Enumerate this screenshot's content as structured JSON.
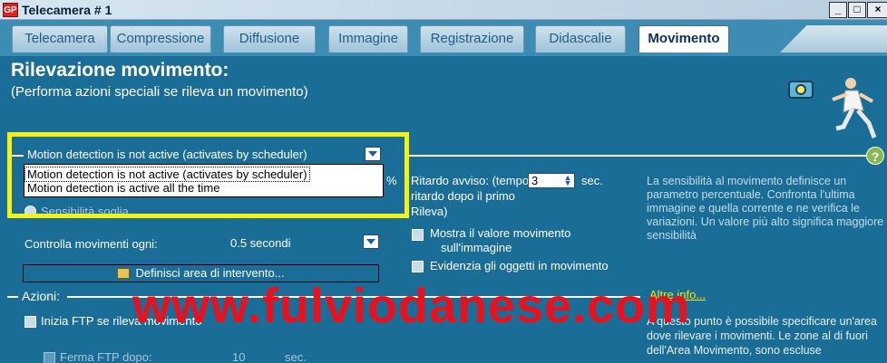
{
  "window": {
    "title": "Telecamera # 1",
    "app_icon": "GP",
    "controls": [
      "_",
      "□",
      "×"
    ]
  },
  "tabs": [
    {
      "label": "Telecamera",
      "active": false
    },
    {
      "label": "Compressione",
      "active": false
    },
    {
      "label": "Diffusione",
      "active": false
    },
    {
      "label": "Immagine",
      "active": false
    },
    {
      "label": "Registrazione",
      "active": false
    },
    {
      "label": "Didascalie",
      "active": false
    },
    {
      "label": "Movimento",
      "active": true
    }
  ],
  "page": {
    "title": "Rilevazione movimento:",
    "subtitle": "(Performa azioni speciali se rileva un movimento)"
  },
  "motion_mode": {
    "selected": "Motion detection is not active (activates by scheduler)",
    "options": [
      "Motion detection is not active (activates by scheduler)",
      "Motion detection is active all the time"
    ],
    "percent_suffix": "%",
    "sensitivity_label": "Sensibilità soglia"
  },
  "delay": {
    "label_line1": "Ritardo avviso: (tempo di",
    "label_line2": "ritardo dopo il primo",
    "label_line3": "Rileva)",
    "value": "3",
    "unit": "sec."
  },
  "checks": {
    "show_value_line1": "Mostra il valore movimento",
    "show_value_line2": "sull'immagine",
    "highlight_objects": "Evidenzia gli oggetti in movimento"
  },
  "interval": {
    "label": "Controlla movimenti ogni:",
    "value": "0.5 secondi"
  },
  "define_area_button": "Definisci area di intervento...",
  "actions": {
    "section_label": "Azioni:",
    "start_ftp": "Inizia FTP se rileva movimento",
    "stop_ftp": "Ferma FTP dopo:",
    "stop_ftp_value": "10",
    "stop_ftp_unit": "sec."
  },
  "info": {
    "sensitivity_text": "La sensibilità al movimento definisce un parametro percentuale. Confronta l'ultima immagine e quella corrente e ne verifica le variazioni. Un valore più alto significa maggiore sensibilità",
    "more_info_link": "Altre info...",
    "area_text": "A questo punto è possibile specificare un'area dove rilevare i movimenti. Le zone al di fuori dell'Area Movimento, sono escluse"
  },
  "help_badge": "?",
  "watermark": "www.fulviodanese.com",
  "colors": {
    "panel_bg": "#1a6d97",
    "highlight": "#f5f20f",
    "watermark": "#e8121e",
    "link": "#f3e600"
  }
}
